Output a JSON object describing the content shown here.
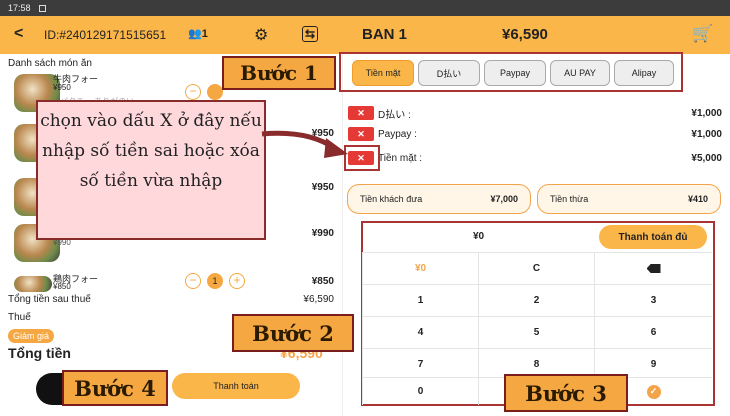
{
  "status_bar": {
    "time": "17:58"
  },
  "header": {
    "back_glyph": "<",
    "order_id": "ID:#240129171515651",
    "people_count": "1",
    "table_name": "BAN 1",
    "total": "¥6,590",
    "icons": [
      "back-arrow-icon",
      "people-icon",
      "gear-icon",
      "switch-icon",
      "cart-icon"
    ]
  },
  "left": {
    "section_title": "Danh sách món ăn",
    "items": [
      {
        "name": "牛肉フォー",
        "price": "¥950",
        "note": "パクチー ありがのい",
        "amount": "",
        "qty": ""
      },
      {
        "name": "",
        "price": "",
        "note": "",
        "amount": "¥950",
        "qty": ""
      },
      {
        "name": "",
        "price": "",
        "note": "",
        "amount": "¥950",
        "qty": ""
      },
      {
        "name": "",
        "price": "¥990",
        "note": "",
        "amount": "¥990",
        "qty": ""
      },
      {
        "name": "鶏肉フォー",
        "price": "¥850",
        "note": "",
        "amount": "¥850",
        "qty": "1"
      }
    ],
    "subtotal_label": "Tổng tiền sau thuế",
    "subtotal_value": "¥6,590",
    "tax_label": "Thuế",
    "discount_label": "Giảm giá",
    "grand_label": "Tổng tiền",
    "grand_value": "¥6,590",
    "pay_label": "Thanh toán"
  },
  "payment": {
    "methods": [
      "Tiền mặt",
      "D払い",
      "Paypay",
      "AU PAY",
      "Alipay"
    ],
    "active_method": "Tiền mặt",
    "paid": [
      {
        "x": "✕",
        "label": "D払い :",
        "amount": "¥1,000"
      },
      {
        "x": "✕",
        "label": "Paypay :",
        "amount": "¥1,000"
      },
      {
        "x": "✕",
        "label": "Tiền mặt :",
        "amount": "¥5,000"
      }
    ],
    "received_label": "Tiền khách đưa",
    "received_value": "¥7,000",
    "change_label": "Tiền thừa",
    "change_value": "¥410",
    "input_value": "¥0",
    "full_pay_label": "Thanh toán đủ",
    "keys": [
      "¥0",
      "C",
      "",
      "1",
      "2",
      "3",
      "4",
      "5",
      "6",
      "7",
      "8",
      "9",
      "0",
      "",
      ""
    ]
  },
  "annotations": {
    "step1": "Bước 1",
    "step2": "Bước 2",
    "step3": "Bước 3",
    "step4": "Bước 4",
    "callout": "chọn vào dấu X ở đây nếu nhập số tiền sai hoặc xóa số tiền vừa nhập"
  },
  "colors": {
    "accent": "#fbb64a",
    "annotation_tag": "#f5a742",
    "x_button": "#e53935",
    "callout_bg": "#ffd8dc"
  }
}
